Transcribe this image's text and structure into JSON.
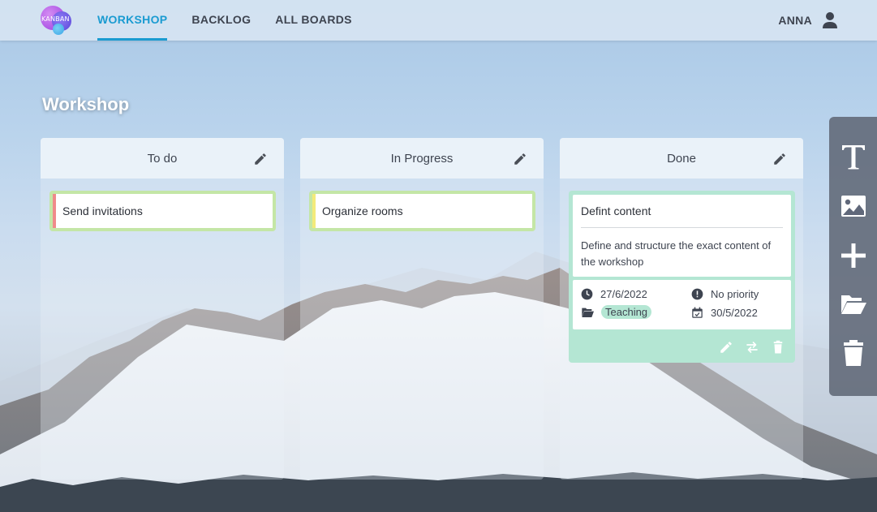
{
  "app": {
    "logo_text": "KANBAN",
    "nav": [
      {
        "label": "WORKSHOP",
        "active": true
      },
      {
        "label": "BACKLOG",
        "active": false
      },
      {
        "label": "ALL BOARDS",
        "active": false
      }
    ],
    "user_name": "ANNA",
    "accent": "#1a9bd1"
  },
  "board": {
    "title": "Workshop",
    "columns": [
      {
        "title": "To do",
        "cards": [
          {
            "title": "Send invitations",
            "border_color": "#c4e6a6",
            "stripe_color": "#f08a8a"
          }
        ]
      },
      {
        "title": "In Progress",
        "cards": [
          {
            "title": "Organize rooms",
            "border_color": "#c4e6a6",
            "stripe_color": "#f3ea7a"
          }
        ]
      },
      {
        "title": "Done",
        "cards": [
          {
            "title": "Defint content",
            "description": "Define and structure the exact content of the workshop",
            "created": "27/6/2022",
            "priority": "No priority",
            "category": "Teaching",
            "due": "30/5/2022",
            "color": "#b4e6d3"
          }
        ]
      }
    ]
  },
  "tools": [
    "text-tool-icon",
    "image-tool-icon",
    "add-icon",
    "folder-open-icon",
    "trash-icon"
  ]
}
